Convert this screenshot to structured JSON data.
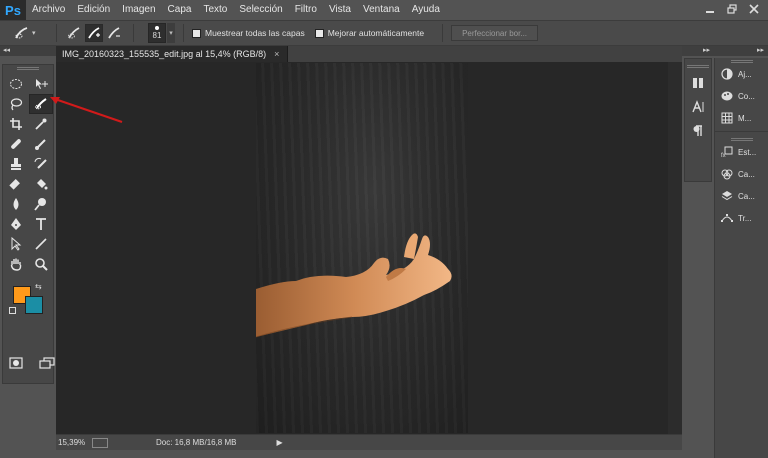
{
  "app": {
    "logo": "Ps"
  },
  "menu": [
    "Archivo",
    "Edición",
    "Imagen",
    "Capa",
    "Texto",
    "Selección",
    "Filtro",
    "Vista",
    "Ventana",
    "Ayuda"
  ],
  "window_controls": [
    "minimize-icon",
    "restore-icon",
    "close-icon"
  ],
  "options_bar": {
    "brush_size": "81",
    "sample_all_layers": "Muestrear todas las capas",
    "auto_enhance": "Mejorar automáticamente",
    "refine_edge": "Perfeccionar bor..."
  },
  "panels": {
    "collapse": "◂◂",
    "expand": "▸▸"
  },
  "document": {
    "tab_title": "IMG_20160323_155535_edit.jpg al 15,4% (RGB/8)",
    "close": "×"
  },
  "status": {
    "zoom": "15,39%",
    "doc_size": "Doc: 16,8 MB/16,8 MB",
    "menu_arrow": "▶"
  },
  "colors": {
    "foreground": "#ff9a1a",
    "background": "#1b8ea5",
    "annotation_arrow": "#d11a1a"
  },
  "right_panels": {
    "items": [
      "Aj...",
      "Co...",
      "M...",
      "Est...",
      "Ca...",
      "Ca...",
      "Tr..."
    ]
  }
}
